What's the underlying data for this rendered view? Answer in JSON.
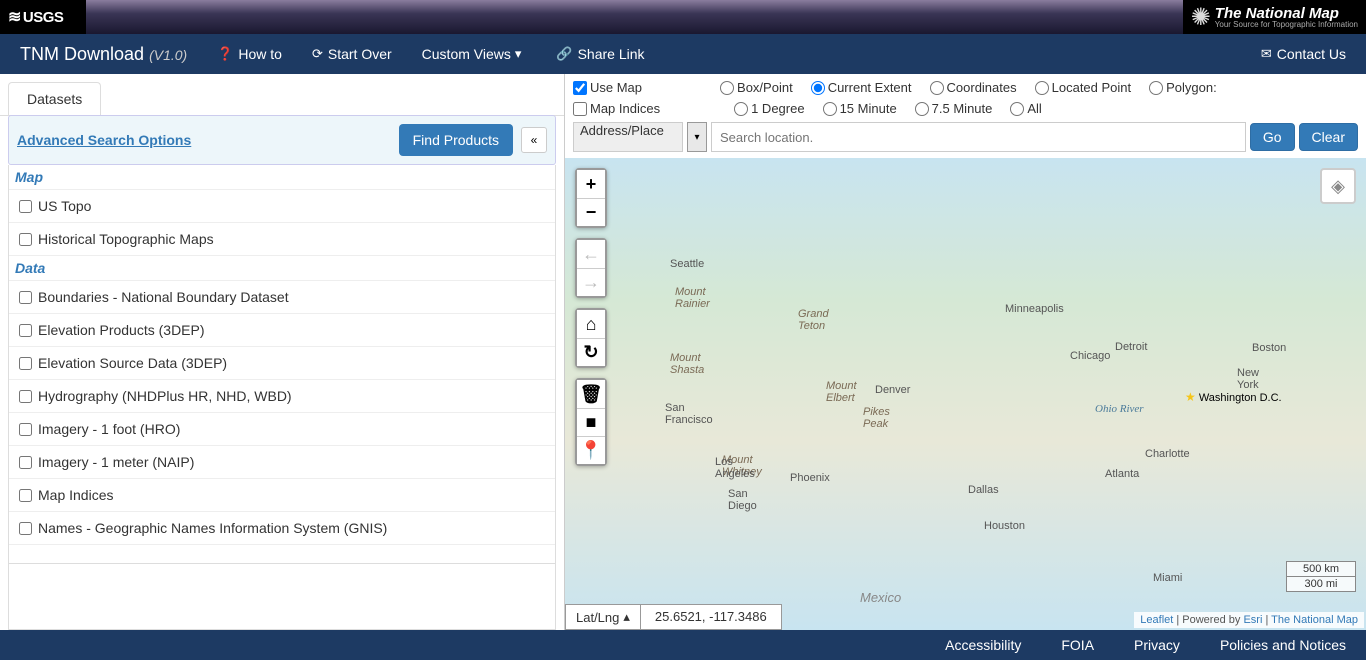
{
  "banner": {
    "usgs": "USGS",
    "tnm_title": "The National Map",
    "tnm_sub": "Your Source for Topographic Information"
  },
  "nav": {
    "brand": "TNM Download",
    "version": "(V1.0)",
    "howto": "How to",
    "startover": "Start Over",
    "customviews": "Custom Views",
    "sharelink": "Share Link",
    "contact": "Contact Us"
  },
  "tabs": {
    "datasets": "Datasets"
  },
  "search": {
    "adv": "Advanced Search Options",
    "find": "Find Products"
  },
  "sections": {
    "map": "Map",
    "data": "Data"
  },
  "datasets": {
    "ustopo": "US Topo",
    "histtopo": "Historical Topographic Maps",
    "boundaries": "Boundaries - National Boundary Dataset",
    "elev3dep": "Elevation Products (3DEP)",
    "elevsrc": "Elevation Source Data (3DEP)",
    "hydro": "Hydrography (NHDPlus HR, NHD, WBD)",
    "img1ft": "Imagery - 1 foot (HRO)",
    "img1m": "Imagery - 1 meter (NAIP)",
    "mapidx": "Map Indices",
    "gnis": "Names - Geographic Names Information System (GNIS)"
  },
  "ctrl": {
    "usemap": "Use Map",
    "boxpoint": "Box/Point",
    "curext": "Current Extent",
    "coords": "Coordinates",
    "locpt": "Located Point",
    "poly": "Polygon:",
    "mapidx": "Map Indices",
    "d1": "1 Degree",
    "m15": "15 Minute",
    "m75": "7.5 Minute",
    "all": "All",
    "addrplace": "Address/Place",
    "placeholder": "Search location.",
    "go": "Go",
    "clear": "Clear"
  },
  "map": {
    "latlng_label": "Lat/Lng",
    "latlng_value": "25.6521, -117.3486",
    "scale_km": "500 km",
    "scale_mi": "300 mi",
    "attrib_leaflet": "Leaflet",
    "attrib_mid": " | Powered by ",
    "attrib_esri": "Esri",
    "attrib_sep": " | ",
    "attrib_tnm": "The National Map"
  },
  "cities": {
    "seattle": "Seattle",
    "rainier": "Mount\nRainier",
    "shasta": "Mount\nShasta",
    "sf": "San\nFrancisco",
    "whitney": "Mount\nWhitney",
    "la": "Los\nAngeles",
    "sd": "San\nDiego",
    "grandteton": "Grand\nTeton",
    "elbert": "Mount\nElbert",
    "pikes": "Pikes\nPeak",
    "denver": "Denver",
    "phoenix": "Phoenix",
    "minneapolis": "Minneapolis",
    "chicago": "Chicago",
    "detroit": "Detroit",
    "dallas": "Dallas",
    "houston": "Houston",
    "atlanta": "Atlanta",
    "charlotte": "Charlotte",
    "miami": "Miami",
    "dc": "Washington D.C.",
    "ny": "New\nYork",
    "boston": "Boston",
    "ohio": "Ohio River",
    "mexico": "Mexico"
  },
  "footer": {
    "access": "Accessibility",
    "foia": "FOIA",
    "privacy": "Privacy",
    "policies": "Policies and Notices"
  }
}
